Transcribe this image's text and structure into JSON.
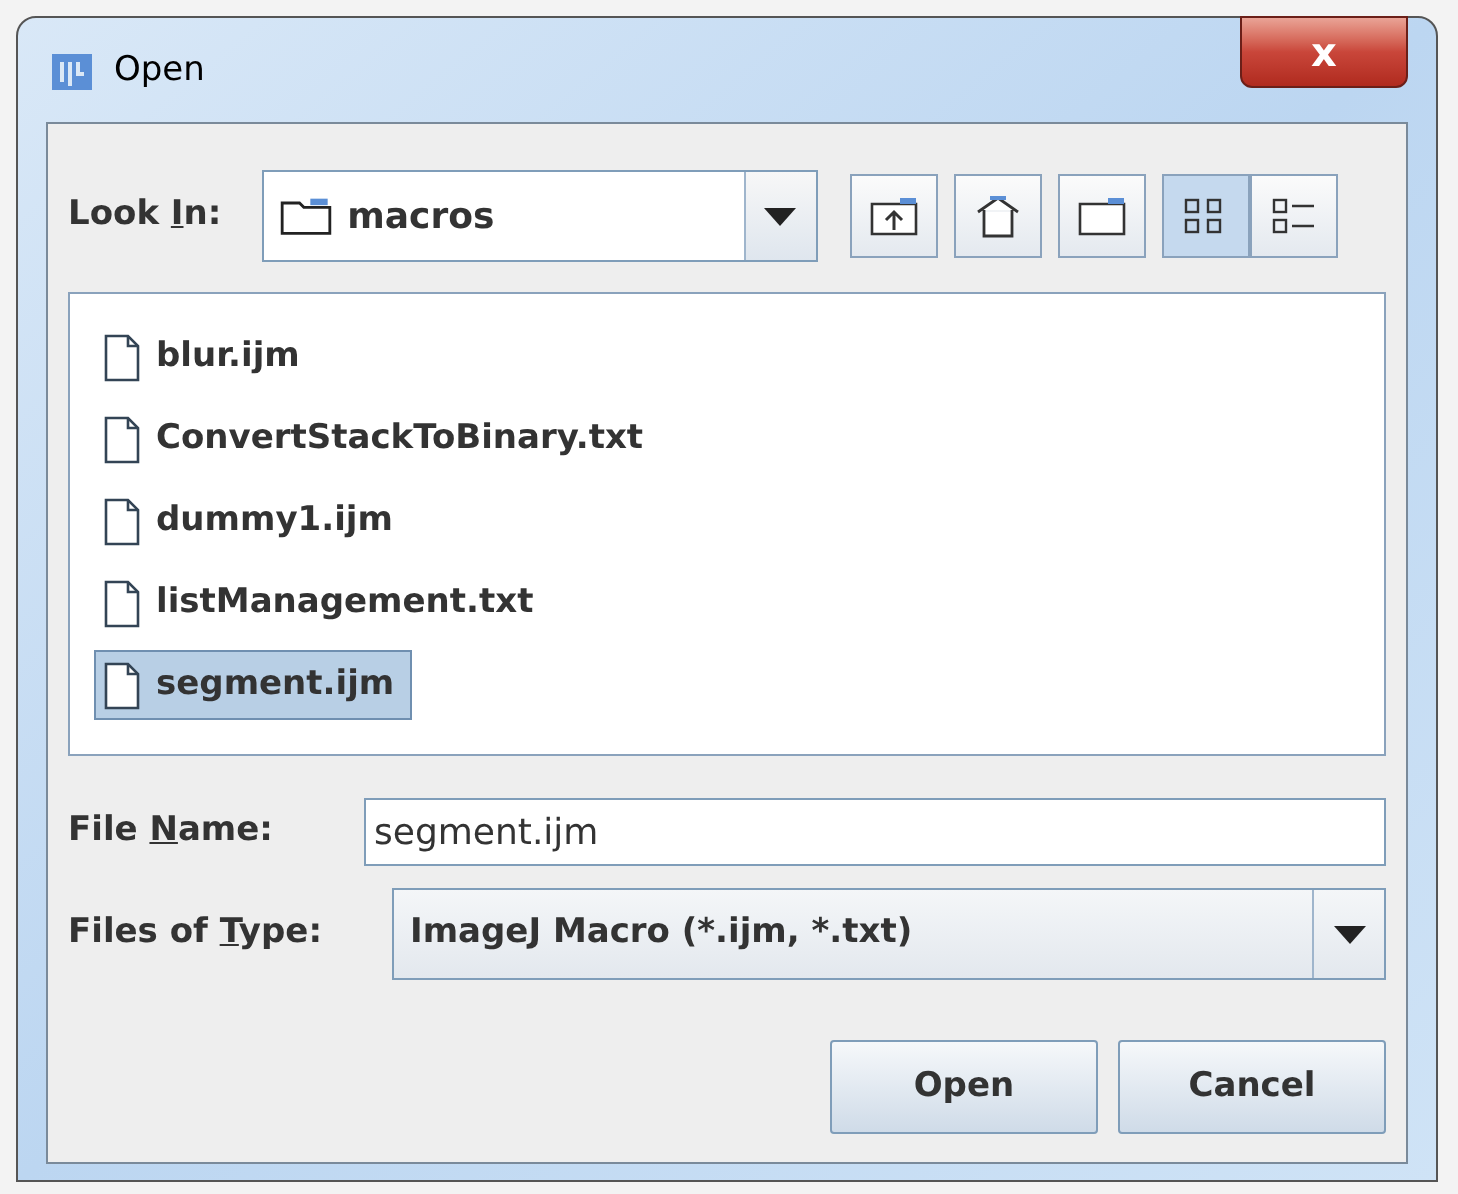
{
  "window": {
    "title": "Open",
    "close_label": "x"
  },
  "look_in": {
    "label_parts": [
      "Look ",
      "I",
      "n:"
    ],
    "value": "macros"
  },
  "toolbar": [
    {
      "kind": "up",
      "selected": false
    },
    {
      "kind": "home",
      "selected": false
    },
    {
      "kind": "new_folder",
      "selected": false
    },
    {
      "kind": "list",
      "selected": true
    },
    {
      "kind": "details",
      "selected": false
    }
  ],
  "files": [
    {
      "name": "blur.ijm",
      "selected": false
    },
    {
      "name": "ConvertStackToBinary.txt",
      "selected": false
    },
    {
      "name": "dummy1.ijm",
      "selected": false
    },
    {
      "name": "listManagement.txt",
      "selected": false
    },
    {
      "name": "segment.ijm",
      "selected": true
    }
  ],
  "file_name": {
    "label_parts": [
      "File ",
      "N",
      "ame:"
    ],
    "value": "segment.ijm"
  },
  "file_type": {
    "label_parts": [
      "Files of ",
      "T",
      "ype:"
    ],
    "value": "ImageJ Macro (*.ijm, *.txt)"
  },
  "buttons": [
    "Open",
    "Cancel"
  ]
}
